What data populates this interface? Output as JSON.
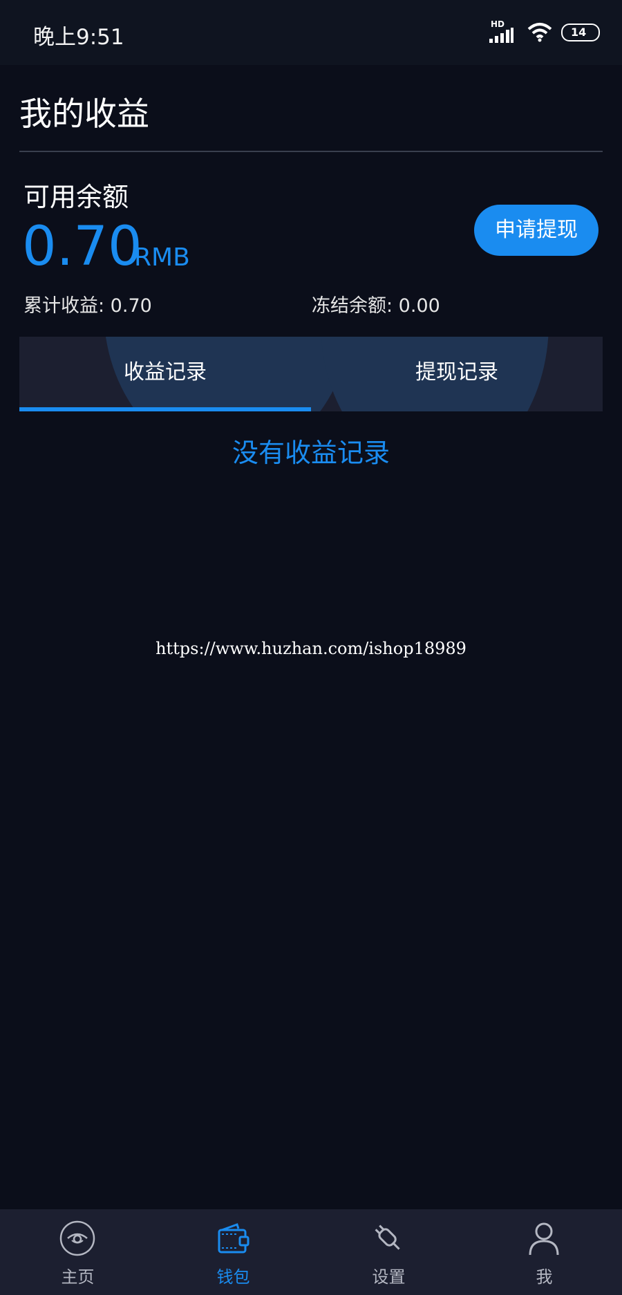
{
  "status_bar": {
    "time": "晚上9:51",
    "network": "HD",
    "battery": "14"
  },
  "header": {
    "title": "我的收益"
  },
  "balance": {
    "label": "可用余额",
    "amount": "0.70",
    "unit": "RMB",
    "withdraw_label": "申请提现",
    "total_earnings": "累计收益: 0.70",
    "frozen_balance": "冻结余额: 0.00"
  },
  "tabs": [
    {
      "label": "收益记录",
      "active": true
    },
    {
      "label": "提现记录",
      "active": false
    }
  ],
  "empty_message": "没有收益记录",
  "watermark": "https://www.huzhan.com/ishop18989",
  "bottom_nav": [
    {
      "label": "主页",
      "icon": "eye-icon",
      "active": false
    },
    {
      "label": "钱包",
      "icon": "wallet-icon",
      "active": true
    },
    {
      "label": "设置",
      "icon": "plug-icon",
      "active": false
    },
    {
      "label": "我",
      "icon": "user-icon",
      "active": false
    }
  ],
  "colors": {
    "accent": "#1a8cf0",
    "background": "#0b0e1a",
    "panel": "#1c1f30"
  }
}
